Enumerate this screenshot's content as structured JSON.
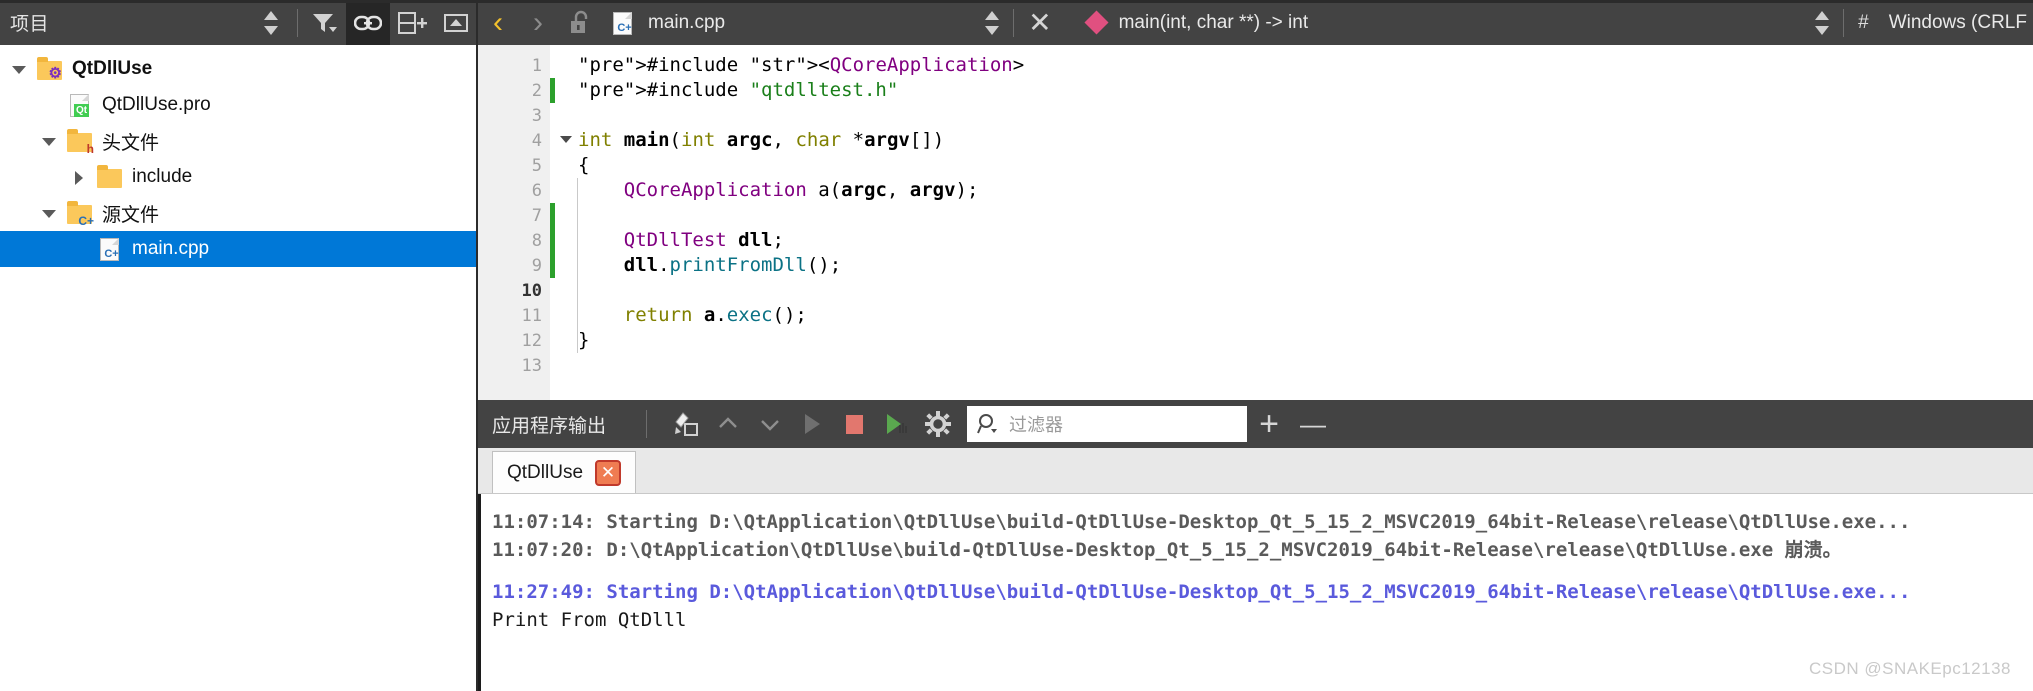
{
  "left_panel": {
    "title": "项目",
    "toolbar": [
      {
        "name": "sync-stepper-icon",
        "glyph": "stepper"
      },
      {
        "name": "filter-icon",
        "glyph": "filter"
      },
      {
        "name": "link-icon",
        "glyph": "link",
        "active": true
      },
      {
        "name": "split-add-icon",
        "glyph": "splitadd"
      },
      {
        "name": "collapse-icon",
        "glyph": "collapse"
      }
    ],
    "tree": [
      {
        "label": "QtDllUse",
        "indent": 0,
        "arrow": "down",
        "icon": "folder-project",
        "badge": "⚙",
        "badge_color": "#7b2fbe",
        "bold": true,
        "selected": false
      },
      {
        "label": "QtDllUse.pro",
        "indent": 1,
        "arrow": "none",
        "icon": "file-qt",
        "badge": "Qt",
        "badge_color": "#41cd52",
        "bold": false,
        "selected": false
      },
      {
        "label": "头文件",
        "indent": 1,
        "arrow": "down",
        "icon": "folder-headers",
        "badge": "h",
        "badge_color": "#c0392b",
        "bold": false,
        "selected": false
      },
      {
        "label": "include",
        "indent": 2,
        "arrow": "right",
        "icon": "folder-plain",
        "badge": "",
        "badge_color": "",
        "bold": false,
        "selected": false
      },
      {
        "label": "源文件",
        "indent": 1,
        "arrow": "down",
        "icon": "folder-sources",
        "badge": "C+",
        "badge_color": "#2a6fb5",
        "bold": false,
        "selected": false
      },
      {
        "label": "main.cpp",
        "indent": 2,
        "arrow": "none",
        "icon": "file-cpp",
        "badge": "C+",
        "badge_color": "#2a6fb5",
        "bold": false,
        "selected": true
      }
    ]
  },
  "editor_bar": {
    "back_glyph": "‹",
    "forward_glyph": "›",
    "lock_name": "unlocked-padlock-icon",
    "file_name": "main.cpp",
    "file_badge": "C+",
    "close_glyph": "✕",
    "symbol_name": "main(int, char **) -> int",
    "hash_glyph": "#",
    "line_ending": "Windows (CRLF"
  },
  "code": {
    "lines": [
      {
        "n": "1",
        "current": false,
        "fold": false,
        "changed": false
      },
      {
        "n": "2",
        "current": false,
        "fold": false,
        "changed": true
      },
      {
        "n": "3",
        "current": false,
        "fold": false,
        "changed": false
      },
      {
        "n": "4",
        "current": false,
        "fold": true,
        "changed": false
      },
      {
        "n": "5",
        "current": false,
        "fold": false,
        "changed": false
      },
      {
        "n": "6",
        "current": false,
        "fold": false,
        "changed": false
      },
      {
        "n": "7",
        "current": false,
        "fold": false,
        "changed": true
      },
      {
        "n": "8",
        "current": false,
        "fold": false,
        "changed": true
      },
      {
        "n": "9",
        "current": false,
        "fold": false,
        "changed": true
      },
      {
        "n": "10",
        "current": true,
        "fold": false,
        "changed": false
      },
      {
        "n": "11",
        "current": false,
        "fold": false,
        "changed": false
      },
      {
        "n": "12",
        "current": false,
        "fold": false,
        "changed": false
      },
      {
        "n": "13",
        "current": false,
        "fold": false,
        "changed": false
      }
    ],
    "text": [
      "#include <QCoreApplication>",
      "#include \"qtdlltest.h\"",
      "",
      "int main(int argc, char *argv[])",
      "{",
      "    QCoreApplication a(argc, argv);",
      "",
      "    QtDllTest dll;",
      "    dll.printFromDll();",
      "",
      "    return a.exec();",
      "}",
      ""
    ]
  },
  "output_panel": {
    "title": "应用程序输出",
    "tools": [
      {
        "name": "clear-output-icon",
        "glyph": "clear"
      },
      {
        "name": "prev-item-icon",
        "glyph": "up"
      },
      {
        "name": "next-item-icon",
        "glyph": "down"
      },
      {
        "name": "run-icon",
        "glyph": "play-grey"
      },
      {
        "name": "stop-icon",
        "glyph": "stop"
      },
      {
        "name": "run-debug-icon",
        "glyph": "play-green"
      },
      {
        "name": "settings-gear-icon",
        "glyph": "gear"
      }
    ],
    "filter_placeholder": "过滤器",
    "add_label": "+",
    "remove_label": "—",
    "tab_label": "QtDllUse",
    "tab_close_glyph": "✕",
    "console_lines": [
      {
        "text": "11:07:14: Starting D:\\QtApplication\\QtDllUse\\build-QtDllUse-Desktop_Qt_5_15_2_MSVC2019_64bit-Release\\release\\QtDllUse.exe...",
        "style": "grey"
      },
      {
        "text": "11:07:20: D:\\QtApplication\\QtDllUse\\build-QtDllUse-Desktop_Qt_5_15_2_MSVC2019_64bit-Release\\release\\QtDllUse.exe 崩溃。",
        "style": "grey"
      },
      {
        "text": "",
        "style": "blank"
      },
      {
        "text": "11:27:49: Starting D:\\QtApplication\\QtDllUse\\build-QtDllUse-Desktop_Qt_5_15_2_MSVC2019_64bit-Release\\release\\QtDllUse.exe...",
        "style": "blue"
      },
      {
        "text": "Print From QtDlll",
        "style": "plain"
      }
    ]
  },
  "watermark": "CSDN @SNAKEpc12138"
}
